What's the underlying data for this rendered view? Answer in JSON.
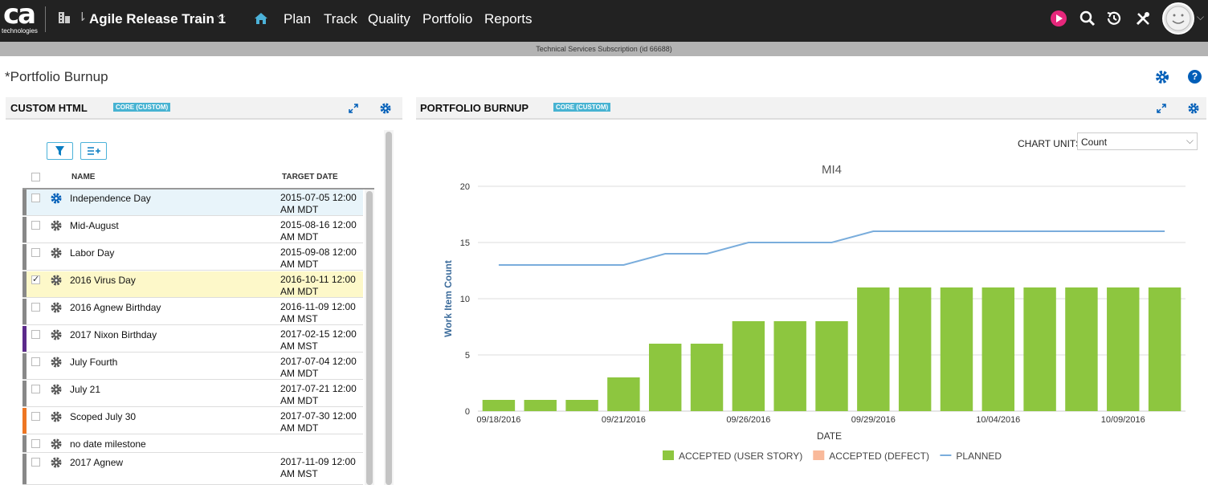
{
  "header": {
    "logo_text": "ca",
    "logo_sub": "technologies",
    "workspace_title": "Agile Release Train 1",
    "nav": [
      "Plan",
      "Track",
      "Quality",
      "Portfolio",
      "Reports"
    ]
  },
  "subscription": "Technical Services Subscription (id 66688)",
  "page_title": "*Portfolio Burnup",
  "left_panel": {
    "title": "CUSTOM HTML",
    "tag": "CORE (CUSTOM)",
    "columns": [
      "NAME",
      "TARGET DATE"
    ],
    "rows": [
      {
        "name": "Independence Day",
        "date": "2015-07-05 12:00 AM MDT",
        "checked": false,
        "selected": true,
        "color": "#888888"
      },
      {
        "name": "Mid-August",
        "date": "2015-08-16 12:00 AM MDT",
        "checked": false,
        "selected": false,
        "color": "#888888"
      },
      {
        "name": "Labor Day",
        "date": "2015-09-08 12:00 AM MDT",
        "checked": false,
        "selected": false,
        "color": "#888888"
      },
      {
        "name": "2016 Virus Day",
        "date": "2016-10-11 12:00 AM MDT",
        "checked": true,
        "selected": false,
        "color": "#888888"
      },
      {
        "name": "2016 Agnew Birthday",
        "date": "2016-11-09 12:00 AM MST",
        "checked": false,
        "selected": false,
        "color": "#888888"
      },
      {
        "name": "2017 Nixon Birthday",
        "date": "2017-02-15 12:00 AM MST",
        "checked": false,
        "selected": false,
        "color": "#5b2a8a"
      },
      {
        "name": "July Fourth",
        "date": "2017-07-04 12:00 AM MDT",
        "checked": false,
        "selected": false,
        "color": "#888888"
      },
      {
        "name": "July 21",
        "date": "2017-07-21 12:00 AM MDT",
        "checked": false,
        "selected": false,
        "color": "#888888"
      },
      {
        "name": "Scoped July 30",
        "date": "2017-07-30 12:00 AM MDT",
        "checked": false,
        "selected": false,
        "color": "#ee7623"
      },
      {
        "name": "no date milestone",
        "date": "",
        "checked": false,
        "selected": false,
        "color": "#888888"
      },
      {
        "name": "2017 Agnew",
        "date": "2017-11-09 12:00 AM MST",
        "checked": false,
        "selected": false,
        "color": "#888888"
      }
    ]
  },
  "right_panel": {
    "title": "PORTFOLIO BURNUP",
    "tag": "CORE (CUSTOM)",
    "units_label": "CHART UNITS",
    "units_value": "Count"
  },
  "chart_data": {
    "type": "bar",
    "title": "MI4",
    "xlabel": "DATE",
    "ylabel": "Work Item Count",
    "ylim": [
      0,
      20
    ],
    "yticks": [
      0,
      5,
      10,
      15,
      20
    ],
    "x": [
      "09/18/2016",
      "09/19/2016",
      "09/20/2016",
      "09/21/2016",
      "09/22/2016",
      "09/23/2016",
      "09/26/2016",
      "09/27/2016",
      "09/28/2016",
      "09/29/2016",
      "09/30/2016",
      "10/03/2016",
      "10/04/2016",
      "10/05/2016",
      "10/06/2016",
      "10/07/2016",
      "10/09/2016"
    ],
    "xtick_labels": [
      "09/18/2016",
      "09/21/2016",
      "09/26/2016",
      "09/29/2016",
      "10/04/2016",
      "10/09/2016"
    ],
    "xtick_positions": [
      0,
      3,
      6,
      9,
      12,
      15
    ],
    "series": [
      {
        "name": "ACCEPTED (USER STORY)",
        "type": "bar",
        "color": "#8dc63f",
        "values": [
          1,
          1,
          1,
          3,
          6,
          6,
          8,
          8,
          8,
          11,
          11,
          11,
          11,
          11,
          11,
          11,
          11
        ]
      },
      {
        "name": "ACCEPTED (DEFECT)",
        "type": "bar",
        "color": "#f9b99a",
        "values": [
          0,
          0,
          0,
          0,
          0,
          0,
          0,
          0,
          0,
          0,
          0,
          0,
          0,
          0,
          0,
          0,
          0
        ]
      },
      {
        "name": "PLANNED",
        "type": "line",
        "color": "#7aaddc",
        "values": [
          13,
          13,
          13,
          13,
          14,
          14,
          15,
          15,
          15,
          16,
          16,
          16,
          16,
          16,
          16,
          16,
          16
        ]
      }
    ],
    "grid": true,
    "legend": "bottom"
  }
}
